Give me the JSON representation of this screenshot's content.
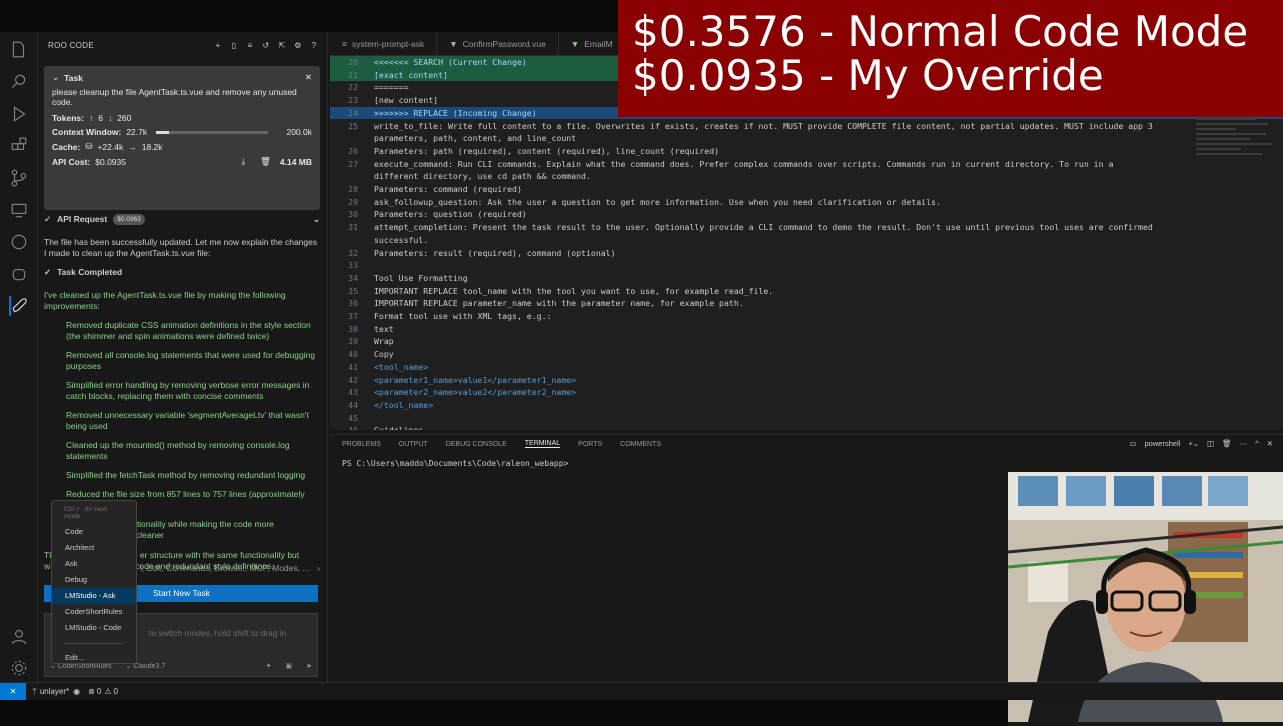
{
  "overlay": {
    "line1": "$0.3576 - Normal Code Mode",
    "line2": "$0.0935 - My Override"
  },
  "sidebar": {
    "title": "ROO CODE",
    "task": {
      "label": "Task",
      "text": "please cleanup the file AgentTask.ts.vue and remove any unused code.",
      "tokens_label": "Tokens:",
      "tokens_up": "6",
      "tokens_down": "260",
      "context_label": "Context Window:",
      "context_used": "22.7k",
      "context_max": "200.0k",
      "context_fraction": 0.114,
      "cache_label": "Cache:",
      "cache_write": "+22.4k",
      "cache_read": "18.2k",
      "api_label": "API Cost:",
      "api_cost": "$0.0935",
      "size": "4.14 MB"
    },
    "api_request": {
      "label": "API Request",
      "cost": "$0.0363"
    },
    "message1": "The file has been successfully updated. Let me now explain the changes I made to clean up the AgentTask.ts.vue file:",
    "completed_label": "Task Completed",
    "summary": "I've cleaned up the AgentTask.ts.vue file by making the following improvements:",
    "bullets": [
      "Removed duplicate CSS animation definitions in the style section (the shimmer and spin animations were defined twice)",
      "Removed all console.log statements that were used for debugging purposes",
      "Simplified error handling by removing verbose error messages in catch blocks, replacing them with concise comments",
      "Removed unnecessary variable 'segmentAverageLtv' that wasn't being used",
      "Cleaned up the mounted() method by removing console.log statements",
      "Simplified the fetchTask method by removing redundant logging",
      "Reduced the file size from 857 lines to 757 lines (approximately 12% reduction)",
      "Maintained all functionality while making the code more"
    ],
    "bullet8_tail": "cleaner",
    "closing_fragment1": "er structure with the same functionality but",
    "closing_fragment2": "code and redundant style definitions.",
    "closing_prefix": "Th",
    "closing_prefix2": "w",
    "auto_approve": "l, Edit, Commands, Browser, MCP, Modes, ...",
    "start_button": "Start New Task",
    "input_placeholder": "to switch modes, hold shift to drag in",
    "footer_mode": "CoderShortRules",
    "footer_model": "Claude3.7"
  },
  "mode_menu": {
    "hint": "Ctrl + . for next mode",
    "items": [
      "Code",
      "Architect",
      "Ask",
      "Debug",
      "LMStudio - Ask",
      "CoderShortRules",
      "LMStudio - Code"
    ],
    "selected": "LMStudio - Ask",
    "edit": "Edit..."
  },
  "tabs": [
    "system-prompt-ask",
    "ConfirmPassword.vue",
    "EmailM"
  ],
  "editor_lines": [
    {
      "n": "20",
      "t": "<<<<<<< SEARCH (Current Change)",
      "hl": "cur"
    },
    {
      "n": "21",
      "t": "[exact content]",
      "hl": "cur"
    },
    {
      "n": "22",
      "t": "=======",
      "hl": ""
    },
    {
      "n": "23",
      "t": "[new content]",
      "hl": ""
    },
    {
      "n": "24",
      "t": ">>>>>>> REPLACE (Incoming Change)",
      "hl": "inc"
    },
    {
      "n": "25",
      "t": "write_to_file: Write full content to a file. Overwrites if exists, creates if not. MUST provide COMPLETE file content, not partial updates. MUST include app 3",
      "hl": ""
    },
    {
      "n": "",
      "t": "parameters, path, content, and line_count",
      "hl": ""
    },
    {
      "n": "26",
      "t": "Parameters: path (required), content (required), line_count (required)",
      "hl": ""
    },
    {
      "n": "27",
      "t": "execute_command: Run CLI commands. Explain what the command does. Prefer complex commands over scripts. Commands run in current directory. To run in a",
      "hl": ""
    },
    {
      "n": "",
      "t": "different directory, use cd path && command.",
      "hl": ""
    },
    {
      "n": "28",
      "t": "Parameters: command (required)",
      "hl": ""
    },
    {
      "n": "29",
      "t": "ask_followup_question: Ask the user a question to get more information. Use when you need clarification or details.",
      "hl": ""
    },
    {
      "n": "30",
      "t": "Parameters: question (required)",
      "hl": ""
    },
    {
      "n": "31",
      "t": "attempt_completion: Present the task result to the user. Optionally provide a CLI command to demo the result. Don't use until previous tool uses are confirmed",
      "hl": ""
    },
    {
      "n": "",
      "t": "successful.",
      "hl": ""
    },
    {
      "n": "32",
      "t": "Parameters: result (required), command (optional)",
      "hl": ""
    },
    {
      "n": "33",
      "t": "",
      "hl": ""
    },
    {
      "n": "34",
      "t": "Tool Use Formatting",
      "hl": ""
    },
    {
      "n": "35",
      "t": "IMPORTANT REPLACE tool_name with the tool you want to use, for example read_file.",
      "hl": ""
    },
    {
      "n": "36",
      "t": "IMPORTANT REPLACE parameter_name with the parameter name, for example path.",
      "hl": ""
    },
    {
      "n": "37",
      "t": "Format tool use with XML tags, e.g.:",
      "hl": ""
    },
    {
      "n": "38",
      "t": "text",
      "hl": ""
    },
    {
      "n": "39",
      "t": "Wrap",
      "hl": ""
    },
    {
      "n": "40",
      "t": "Copy",
      "hl": ""
    },
    {
      "n": "41",
      "t": "<tool_name>",
      "hl": "tag"
    },
    {
      "n": "42",
      "t": "<parameter1_name>value1</parameter1_name>",
      "hl": "tag"
    },
    {
      "n": "43",
      "t": "<parameter2_name>value2</parameter2_name>",
      "hl": "tag"
    },
    {
      "n": "44",
      "t": "</tool_name>",
      "hl": "tag"
    },
    {
      "n": "45",
      "t": "",
      "hl": ""
    },
    {
      "n": "46",
      "t": "Guidelines",
      "hl": ""
    }
  ],
  "panel": {
    "tabs": [
      "PROBLEMS",
      "OUTPUT",
      "DEBUG CONSOLE",
      "TERMINAL",
      "PORTS",
      "COMMENTS"
    ],
    "active": "TERMINAL",
    "shell": "powershell",
    "prompt": "PS C:\\Users\\maddo\\Documents\\Code\\raleon_webapp>"
  },
  "status": {
    "branch": "unlayer*",
    "errors": "0",
    "warnings": "0"
  },
  "colors": {
    "overlay": "#8b0000",
    "accent": "#0e70c0",
    "green": "#89d185"
  }
}
